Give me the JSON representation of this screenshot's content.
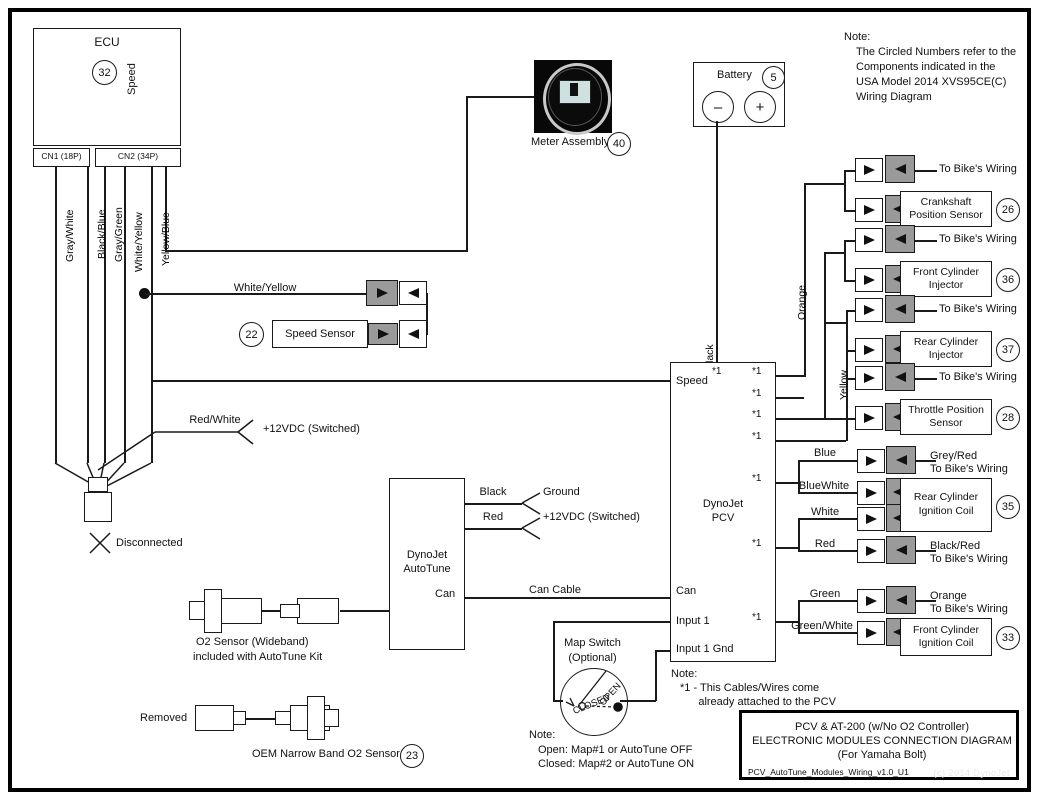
{
  "diagram": {
    "title_block": {
      "line1": "PCV & AT-200 (w/No O2 Controller)",
      "line2": "ELECTRONIC MODULES CONNECTION DIAGRAM",
      "line3": "(For Yamaha Bolt)",
      "filename": "PCV_AutoTune_Modules_Wiring_v1.0_U1",
      "watermark": "(c) 2014 DynoJet"
    },
    "top_note": {
      "heading": "Note:",
      "lines": [
        "The Circled Numbers refer to the",
        "Components indicated in the",
        "USA Model 2014 XVS95CE(C)",
        "Wiring Diagram"
      ]
    },
    "pcv_note": {
      "heading": "Note:",
      "lines": [
        "*1 - This Cables/Wires come",
        "      already attached to the PCV"
      ]
    },
    "map_note": {
      "heading": "Note:",
      "lines": [
        "Open: Map#1 or AutoTune OFF",
        "Closed: Map#2 or AutoTune ON"
      ]
    },
    "ecu": {
      "label": "ECU",
      "ref": "32",
      "speed_label": "Speed",
      "connectors": [
        {
          "label": "CN1 (18P)"
        },
        {
          "label": "CN2 (34P)"
        }
      ],
      "wires": [
        "Gray/White",
        "Black/Blue",
        "Gray/Green",
        "White/Yellow",
        "Yellow/Blue"
      ],
      "disconnected_label": "Disconnected",
      "red_white_wire": "Red/White",
      "red_white_dest": "+12VDC (Switched)"
    },
    "meter": {
      "label": "Meter Assembly",
      "ref": "40"
    },
    "battery": {
      "label": "Battery",
      "ref": "5",
      "minus": "–",
      "plus": "+"
    },
    "speed_sensor": {
      "label": "Speed Sensor",
      "ref": "22",
      "wire": "White/Yellow"
    },
    "pcv": {
      "name_line1": "DynoJet",
      "name_line2": "PCV",
      "pins_left": [
        "Speed",
        "Can",
        "Input 1",
        "Input 1 Gnd"
      ],
      "star": "*1",
      "vertical_wires": [
        "Black",
        "Orange",
        "Yellow"
      ]
    },
    "autotune": {
      "name_line1": "DynoJet",
      "name_line2": "AutoTune",
      "pins": [
        {
          "wire": "Black",
          "dest": "Ground"
        },
        {
          "wire": "Red",
          "dest": "+12VDC (Switched)"
        }
      ],
      "can_pin": "Can",
      "can_cable": "Can Cable"
    },
    "o2_wideband": {
      "line1": "O2 Sensor (Wideband)",
      "line2": "included with AutoTune Kit"
    },
    "o2_narrowband": {
      "removed": "Removed",
      "label": "OEM Narrow Band O2 Sensor",
      "ref": "23"
    },
    "map_switch": {
      "line1": "Map Switch",
      "line2": "(Optional)",
      "open": "OPEN",
      "closed": "CLOSED"
    },
    "right_modules": [
      {
        "bike": "To Bike's Wiring",
        "component_line1": "Crankshaft",
        "component_line2": "Position Sensor",
        "ref": "26"
      },
      {
        "bike": "To Bike's Wiring",
        "component_line1": "Front Cylinder",
        "component_line2": "Injector",
        "ref": "36"
      },
      {
        "bike": "To Bike's Wiring",
        "component_line1": "Rear Cylinder",
        "component_line2": "Injector",
        "ref": "37"
      },
      {
        "bike": "To Bike's Wiring",
        "component_line1": "Throttle Position",
        "component_line2": "Sensor",
        "ref": "28"
      }
    ],
    "coils": [
      {
        "ref": "35",
        "component_line1": "Rear Cylinder",
        "component_line2": "Ignition Coil",
        "wires": [
          "Blue",
          "BlueWhite",
          "White",
          "Red"
        ],
        "bike_top_line1": "Grey/Red",
        "bike_top_line2": "To Bike's Wiring",
        "bike_bottom_line1": "Black/Red",
        "bike_bottom_line2": "To Bike's Wiring"
      },
      {
        "ref": "33",
        "component_line1": "Front Cylinder",
        "component_line2": "Ignition Coil",
        "wires": [
          "Green",
          "Green/White"
        ],
        "bike_top_line1": "Orange",
        "bike_top_line2": "To Bike's Wiring"
      }
    ]
  }
}
